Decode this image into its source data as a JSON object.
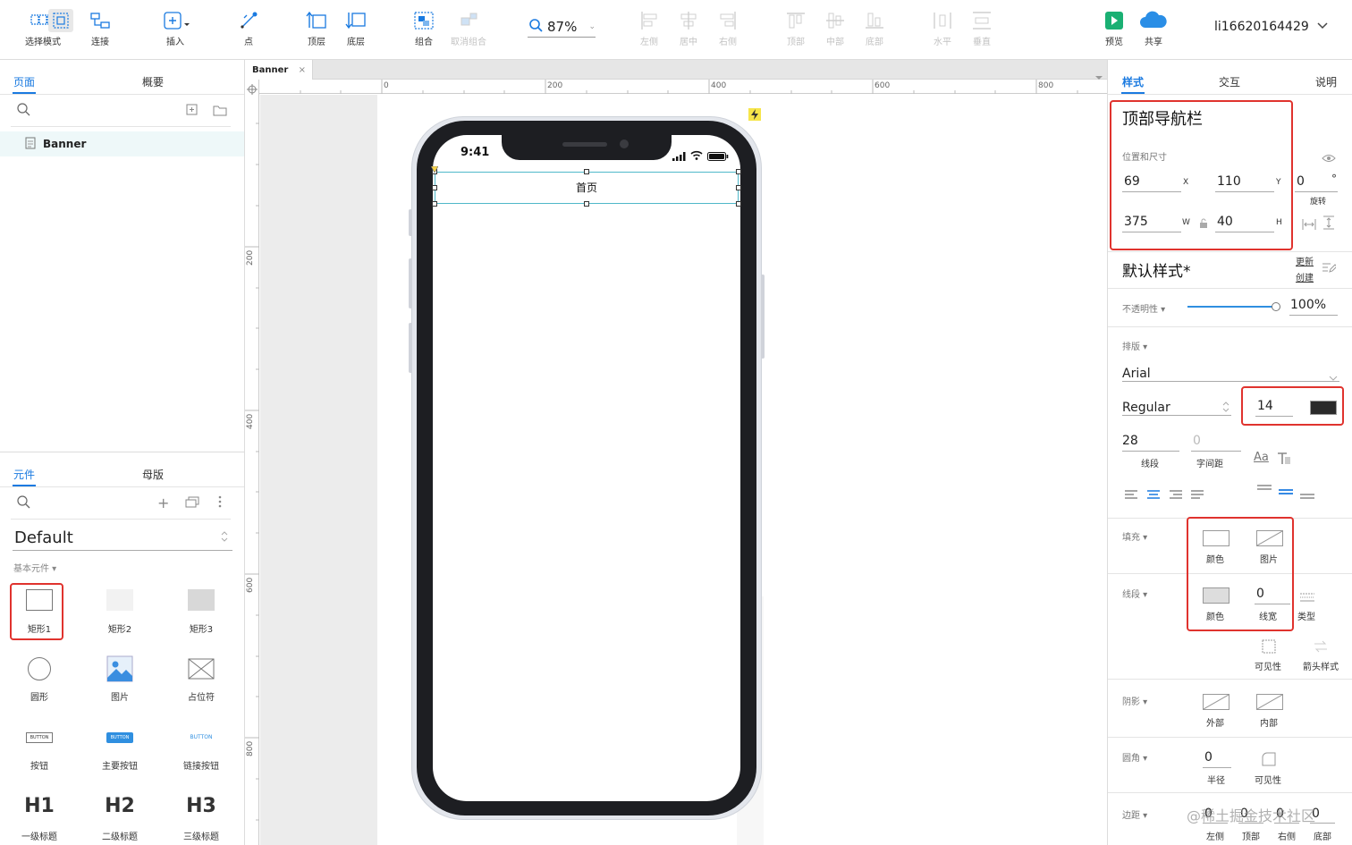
{
  "toolbar": {
    "select_mode": "选择模式",
    "connect": "连接",
    "insert": "插入",
    "point": "点",
    "top_layer": "顶层",
    "bottom_layer": "底层",
    "group": "组合",
    "ungroup": "取消组合",
    "zoom": "87%",
    "align_left": "左侧",
    "align_center": "居中",
    "align_right": "右侧",
    "align_top": "顶部",
    "align_middle": "中部",
    "align_bottom": "底部",
    "dist_h": "水平",
    "dist_v": "垂直",
    "preview": "预览",
    "share": "共享",
    "user": "li16620164429"
  },
  "left": {
    "tab_pages": "页面",
    "tab_outline": "概要",
    "page_name": "Banner",
    "tab_widgets": "元件",
    "tab_masters": "母版",
    "library": "Default",
    "section": "基本元件 ▾",
    "widgets": [
      {
        "label": "矩形1"
      },
      {
        "label": "矩形2"
      },
      {
        "label": "矩形3"
      },
      {
        "label": "圆形"
      },
      {
        "label": "图片"
      },
      {
        "label": "占位符"
      },
      {
        "label": "按钮",
        "text": "BUTTON"
      },
      {
        "label": "主要按钮",
        "text": "BUTTON"
      },
      {
        "label": "链接按钮",
        "text": "BUTTON"
      },
      {
        "label": "一级标题",
        "text": "H1"
      },
      {
        "label": "二级标题",
        "text": "H2"
      },
      {
        "label": "三级标题",
        "text": "H3"
      }
    ]
  },
  "canvas": {
    "tab": "Banner",
    "ruler_h": [
      "0",
      "200",
      "400",
      "600",
      "800"
    ],
    "ruler_v": [
      "200",
      "400",
      "600",
      "800"
    ],
    "time": "9:41",
    "nav_label": "首页"
  },
  "right": {
    "tab_style": "样式",
    "tab_interact": "交互",
    "tab_notes": "说明",
    "element_name": "顶部导航栏",
    "pos_size_label": "位置和尺寸",
    "x": "69",
    "x_label": "X",
    "y": "110",
    "y_label": "Y",
    "rotation": "0",
    "rotation_unit": "°",
    "rotation_label": "旋转",
    "w": "375",
    "w_label": "W",
    "h": "40",
    "h_label": "H",
    "style_name": "默认样式*",
    "update": "更新",
    "create": "创建",
    "opacity_label": "不透明性 ▾",
    "opacity": "100%",
    "typography_label": "排版 ▾",
    "font": "Arial",
    "weight": "Regular",
    "font_size": "14",
    "line_height": "28",
    "line_height_label": "线段",
    "letter_spacing": "0",
    "letter_spacing_label": "字间距",
    "text_case": "Aa",
    "fill_label": "填充 ▾",
    "fill_color": "颜色",
    "fill_image": "图片",
    "border_label": "线段 ▾",
    "border_color": "颜色",
    "border_width": "0",
    "border_width_label": "线宽",
    "border_type": "类型",
    "visibility": "可见性",
    "arrow_style": "箭头样式",
    "shadow_label": "阴影 ▾",
    "shadow_outer": "外部",
    "shadow_inner": "内部",
    "radius_label": "圆角 ▾",
    "radius": "0",
    "radius_label2": "半径",
    "radius_visibility": "可见性",
    "padding_label": "边距 ▾",
    "padding_values": [
      "0",
      "0",
      "0",
      "0"
    ],
    "padding_left": "左侧",
    "padding_top": "顶部",
    "padding_right": "右侧",
    "padding_bottom": "底部",
    "watermark": "@稀土掘金技术社区"
  },
  "colors": {
    "accent": "#1a7ae0",
    "highlight": "#e0332e",
    "selection": "#4fb8c9",
    "phone_frame": "#1d1e22"
  }
}
